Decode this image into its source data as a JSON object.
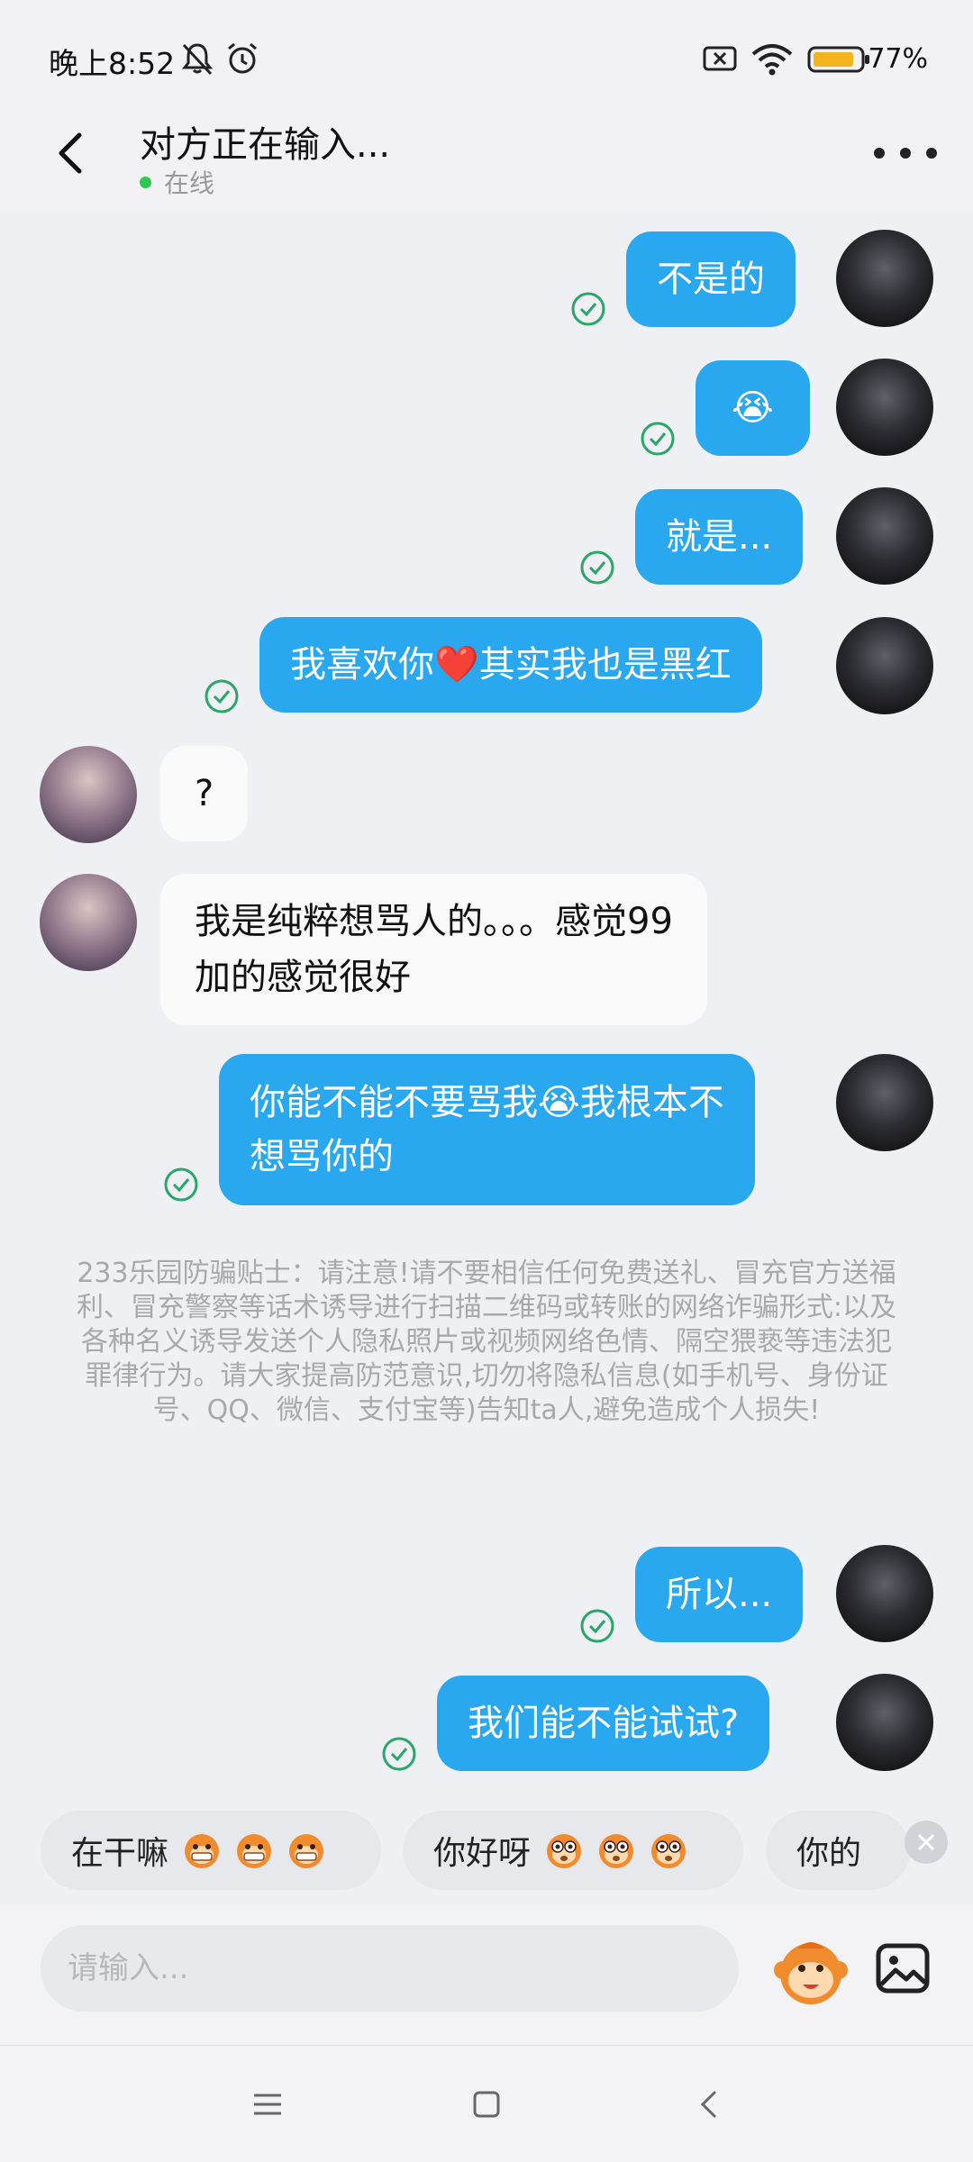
{
  "status_bar": {
    "time": "晚上8:52",
    "battery": "77%"
  },
  "header": {
    "title": "对方正在输入...",
    "status": "在线"
  },
  "messages": [
    {
      "side": "me",
      "text": "不是的"
    },
    {
      "side": "me",
      "text": "😭"
    },
    {
      "side": "me",
      "text": "就是..."
    },
    {
      "side": "me",
      "text": "我喜欢你❤️其实我也是黑红"
    },
    {
      "side": "other",
      "text": "?"
    },
    {
      "side": "other",
      "line1": "我是纯粹想骂人的。。。感觉99",
      "line2": "加的感觉很好"
    },
    {
      "side": "me",
      "line1": "你能不能不要骂我😭我根本不",
      "line2": "想骂你的"
    },
    {
      "side": "me",
      "text": "所以..."
    },
    {
      "side": "me",
      "text": "我们能不能试试?"
    }
  ],
  "safety_tip": "233乐园防骗贴士：请注意!请不要相信任何免费送礼、冒充官方送福利、冒充警察等话术诱导进行扫描二维码或转账的网络诈骗形式:以及各种名义诱导发送个人隐私照片或视频网络色情、隔空猥亵等违法犯罪律行为。请大家提高防范意识,切勿将隐私信息(如手机号、身份证号、QQ、微信、支付宝等)告知ta人,避免造成个人损失!",
  "quick_replies": [
    "在干嘛",
    "你好呀",
    "你的"
  ],
  "input": {
    "placeholder": "请输入..."
  },
  "colors": {
    "my_bubble": "#2aa8ef",
    "other_bubble": "#fafafb",
    "read_check": "#2aa66a",
    "online_dot": "#2dc84d"
  }
}
